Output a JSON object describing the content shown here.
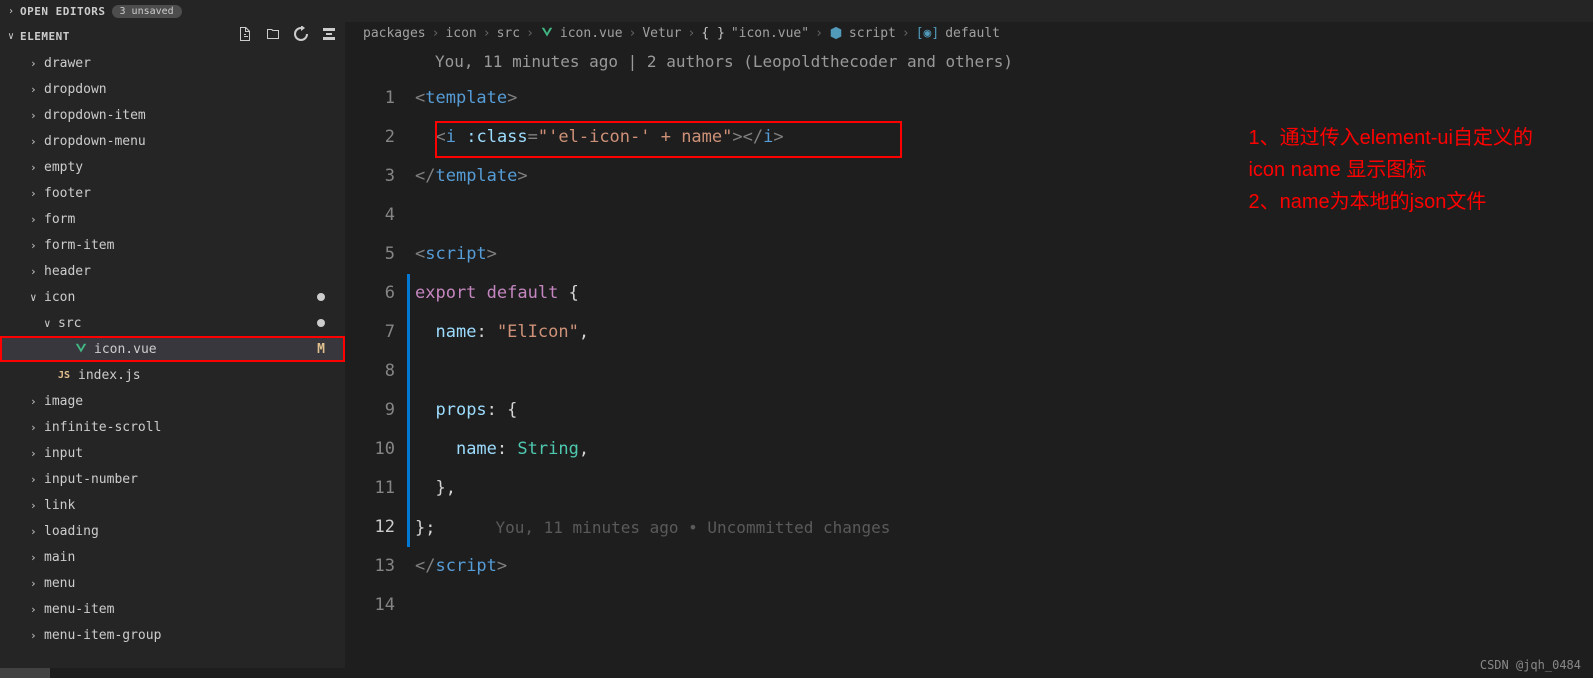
{
  "topbar": {
    "open_editors_label": "OPEN EDITORS",
    "unsaved_badge": "3 unsaved"
  },
  "sidebar": {
    "title": "ELEMENT",
    "tree": [
      {
        "label": "drawer",
        "indent": 0,
        "chevron": ">"
      },
      {
        "label": "dropdown",
        "indent": 0,
        "chevron": ">"
      },
      {
        "label": "dropdown-item",
        "indent": 0,
        "chevron": ">"
      },
      {
        "label": "dropdown-menu",
        "indent": 0,
        "chevron": ">"
      },
      {
        "label": "empty",
        "indent": 0,
        "chevron": ">"
      },
      {
        "label": "footer",
        "indent": 0,
        "chevron": ">"
      },
      {
        "label": "form",
        "indent": 0,
        "chevron": ">"
      },
      {
        "label": "form-item",
        "indent": 0,
        "chevron": ">"
      },
      {
        "label": "header",
        "indent": 0,
        "chevron": ">"
      },
      {
        "label": "icon",
        "indent": 0,
        "chevron": "∨",
        "dot": true
      },
      {
        "label": "src",
        "indent": 1,
        "chevron": "∨",
        "dot": true
      },
      {
        "label": "icon.vue",
        "indent": 2,
        "icon": "vue",
        "highlighted": true,
        "modified": "M"
      },
      {
        "label": "index.js",
        "indent": 1,
        "icon": "js"
      },
      {
        "label": "image",
        "indent": 0,
        "chevron": ">"
      },
      {
        "label": "infinite-scroll",
        "indent": 0,
        "chevron": ">"
      },
      {
        "label": "input",
        "indent": 0,
        "chevron": ">"
      },
      {
        "label": "input-number",
        "indent": 0,
        "chevron": ">"
      },
      {
        "label": "link",
        "indent": 0,
        "chevron": ">"
      },
      {
        "label": "loading",
        "indent": 0,
        "chevron": ">"
      },
      {
        "label": "main",
        "indent": 0,
        "chevron": ">"
      },
      {
        "label": "menu",
        "indent": 0,
        "chevron": ">"
      },
      {
        "label": "menu-item",
        "indent": 0,
        "chevron": ">"
      },
      {
        "label": "menu-item-group",
        "indent": 0,
        "chevron": ">"
      }
    ]
  },
  "breadcrumbs": {
    "items": [
      "packages",
      "icon",
      "src",
      "icon.vue",
      "Vetur",
      "\"icon.vue\"",
      "script",
      "default"
    ]
  },
  "blame": "You, 11 minutes ago | 2 authors (Leopoldthecoder and others)",
  "inline_blame": "You, 11 minutes ago • Uncommitted changes",
  "code": {
    "line_numbers": [
      "1",
      "2",
      "3",
      "4",
      "5",
      "6",
      "7",
      "8",
      "9",
      "10",
      "11",
      "12",
      "13",
      "14"
    ],
    "current_line": 12
  },
  "annotation": {
    "line1": "1、通过传入element-ui自定义的",
    "line2": "icon name 显示图标",
    "line3": "2、name为本地的json文件"
  },
  "watermark": "CSDN @jqh_0484"
}
